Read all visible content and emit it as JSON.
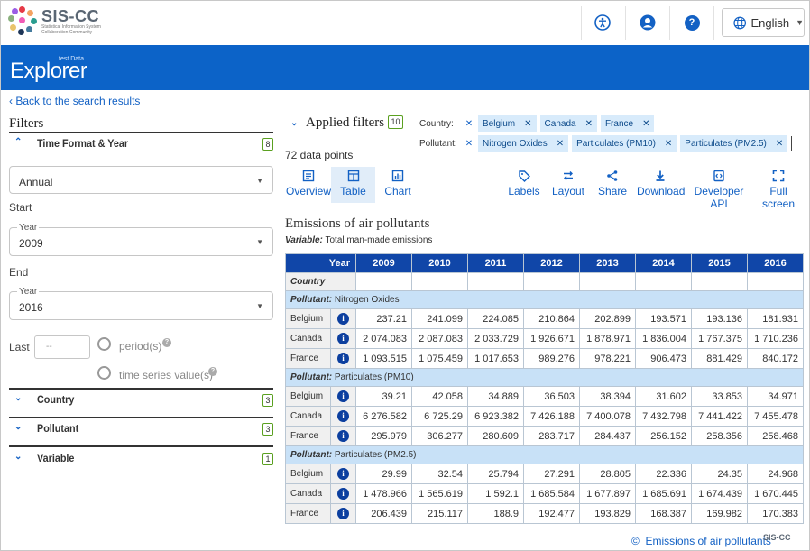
{
  "header": {
    "logo_title": "SIS-CC",
    "logo_subtitle": "Statistical Information System Collaboration Community",
    "language": "English"
  },
  "banner": {
    "brand": "Explorer",
    "tag": "test Data"
  },
  "left": {
    "back_link": "Back to the search results",
    "filters_title": "Filters",
    "sections": [
      {
        "label": "Time Format & Year",
        "count": "8"
      },
      {
        "label": "Country",
        "count": "3"
      },
      {
        "label": "Pollutant",
        "count": "3"
      },
      {
        "label": "Variable",
        "count": "1"
      }
    ],
    "frequency": "Annual",
    "start_label": "Start",
    "start_floating": "Year",
    "start_value": "2009",
    "end_label": "End",
    "end_floating": "Year",
    "end_value": "2016",
    "last_label": "Last",
    "last_placeholder": "--",
    "radio_periods": "period(s)",
    "radio_series": "time series value(s)"
  },
  "applied": {
    "title": "Applied filters",
    "count": "10",
    "data_points": "72 data points",
    "country_label": "Country:",
    "countries": [
      "Belgium",
      "Canada",
      "France"
    ],
    "pollutant_label": "Pollutant:",
    "pollutants": [
      "Nitrogen Oxides",
      "Particulates (PM10)",
      "Particulates (PM2.5)"
    ]
  },
  "toolbar": {
    "overview": "Overview",
    "table": "Table",
    "chart": "Chart",
    "labels": "Labels",
    "layout": "Layout",
    "share": "Share",
    "download": "Download",
    "developer_api": "Developer API",
    "full_screen": "Full screen"
  },
  "table": {
    "title": "Emissions of air pollutants",
    "variable_label": "Variable:",
    "variable_value": "Total man-made emissions",
    "year_header": "Year",
    "country_header": "Country",
    "pollutant_label": "Pollutant:",
    "years": [
      "2009",
      "2010",
      "2011",
      "2012",
      "2013",
      "2014",
      "2015",
      "2016"
    ],
    "groups": [
      {
        "pollutant": "Nitrogen Oxides",
        "rows": [
          {
            "country": "Belgium",
            "values": [
              "237.21",
              "241.099",
              "224.085",
              "210.864",
              "202.899",
              "193.571",
              "193.136",
              "181.931"
            ]
          },
          {
            "country": "Canada",
            "values": [
              "2 074.083",
              "2 087.083",
              "2 033.729",
              "1 926.671",
              "1 878.971",
              "1 836.004",
              "1 767.375",
              "1 710.236"
            ]
          },
          {
            "country": "France",
            "values": [
              "1 093.515",
              "1 075.459",
              "1 017.653",
              "989.276",
              "978.221",
              "906.473",
              "881.429",
              "840.172"
            ]
          }
        ]
      },
      {
        "pollutant": "Particulates (PM10)",
        "rows": [
          {
            "country": "Belgium",
            "values": [
              "39.21",
              "42.058",
              "34.889",
              "36.503",
              "38.394",
              "31.602",
              "33.853",
              "34.971"
            ]
          },
          {
            "country": "Canada",
            "values": [
              "6 276.582",
              "6 725.29",
              "6 923.382",
              "7 426.188",
              "7 400.078",
              "7 432.798",
              "7 441.422",
              "7 455.478"
            ]
          },
          {
            "country": "France",
            "values": [
              "295.979",
              "306.277",
              "280.609",
              "283.717",
              "284.437",
              "256.152",
              "258.356",
              "258.468"
            ]
          }
        ]
      },
      {
        "pollutant": "Particulates (PM2.5)",
        "rows": [
          {
            "country": "Belgium",
            "values": [
              "29.99",
              "32.54",
              "25.794",
              "27.291",
              "28.805",
              "22.336",
              "24.35",
              "24.968"
            ]
          },
          {
            "country": "Canada",
            "values": [
              "1 478.966",
              "1 565.619",
              "1 592.1",
              "1 685.584",
              "1 677.897",
              "1 685.691",
              "1 674.439",
              "1 670.445"
            ]
          },
          {
            "country": "France",
            "values": [
              "206.439",
              "215.117",
              "188.9",
              "192.477",
              "193.829",
              "168.387",
              "169.982",
              "170.383"
            ]
          }
        ]
      }
    ]
  },
  "footer": {
    "copyright": "©",
    "source": "Emissions of air pollutants",
    "mini_logo": "SIS-CC"
  },
  "colors": {
    "accent": "#1361c4",
    "banner": "#0c63c8",
    "table_header": "#1046a8",
    "group_row": "#c8e1f7",
    "badge_border": "#5aa020"
  },
  "icons": [
    "accessibility-icon",
    "account-icon",
    "help-icon",
    "globe-icon",
    "chevron-down-icon",
    "info-icon"
  ]
}
